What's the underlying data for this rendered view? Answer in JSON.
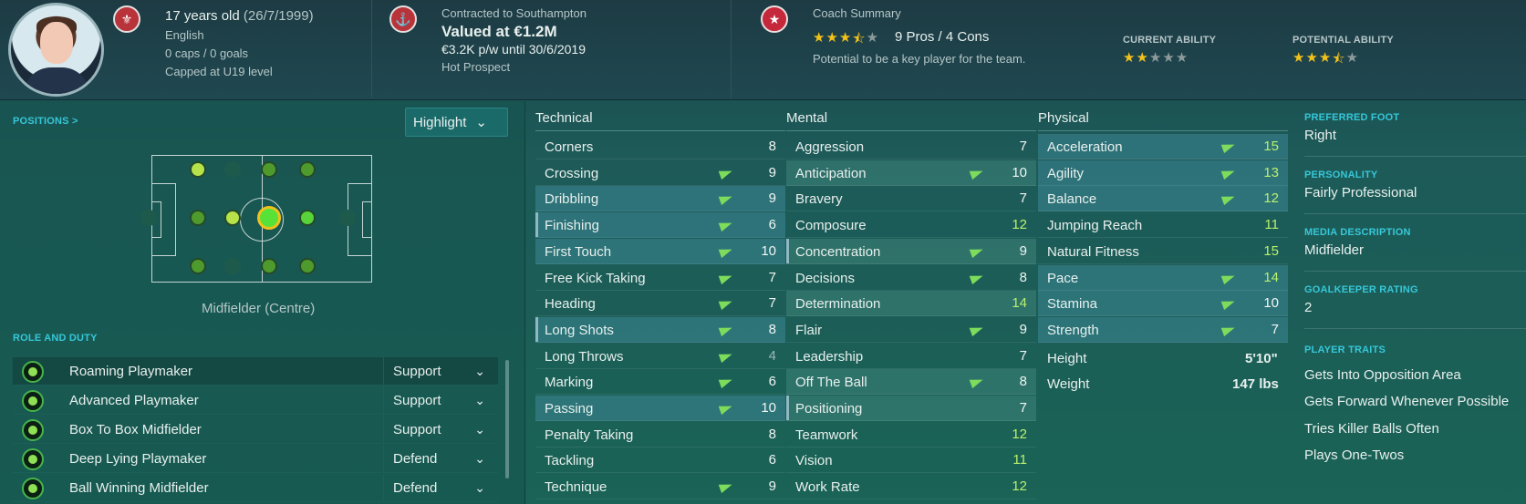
{
  "header": {
    "age": "17 years old",
    "dob": "(26/7/1999)",
    "nationality": "English",
    "caps": "0 caps / 0 goals",
    "capped_level": "Capped at U19 level",
    "contract": "Contracted to Southampton",
    "value": "Valued at €1.2M",
    "wage": "€3.2K p/w until 30/6/2019",
    "status": "Hot Prospect",
    "coach_title": "Coach Summary",
    "coach_rating_stars": 3.5,
    "pros_cons": "9 Pros / 4 Cons",
    "coach_text": "Potential to be a key player for the team.",
    "current_ability_label": "CURRENT ABILITY",
    "current_ability_stars": 2,
    "potential_ability_label": "POTENTIAL ABILITY",
    "potential_ability_stars": 3.5
  },
  "left": {
    "positions_label": "POSITIONS >",
    "highlight_label": "Highlight",
    "position_caption": "Midfielder (Centre)",
    "role_duty_label": "ROLE AND DUTY",
    "roles": [
      {
        "name": "Roaming Playmaker",
        "duty": "Support"
      },
      {
        "name": "Advanced Playmaker",
        "duty": "Support"
      },
      {
        "name": "Box To Box Midfielder",
        "duty": "Support"
      },
      {
        "name": "Deep Lying Playmaker",
        "duty": "Defend"
      },
      {
        "name": "Ball Winning Midfielder",
        "duty": "Defend"
      }
    ]
  },
  "attributes": {
    "technical_label": "Technical",
    "mental_label": "Mental",
    "physical_label": "Physical",
    "technical": [
      {
        "name": "Corners",
        "value": "8"
      },
      {
        "name": "Crossing",
        "value": "9"
      },
      {
        "name": "Dribbling",
        "value": "9"
      },
      {
        "name": "Finishing",
        "value": "6"
      },
      {
        "name": "First Touch",
        "value": "10"
      },
      {
        "name": "Free Kick Taking",
        "value": "7"
      },
      {
        "name": "Heading",
        "value": "7"
      },
      {
        "name": "Long Shots",
        "value": "8"
      },
      {
        "name": "Long Throws",
        "value": "4"
      },
      {
        "name": "Marking",
        "value": "6"
      },
      {
        "name": "Passing",
        "value": "10"
      },
      {
        "name": "Penalty Taking",
        "value": "8"
      },
      {
        "name": "Tackling",
        "value": "6"
      },
      {
        "name": "Technique",
        "value": "9"
      }
    ],
    "mental": [
      {
        "name": "Aggression",
        "value": "7"
      },
      {
        "name": "Anticipation",
        "value": "10"
      },
      {
        "name": "Bravery",
        "value": "7"
      },
      {
        "name": "Composure",
        "value": "12"
      },
      {
        "name": "Concentration",
        "value": "9"
      },
      {
        "name": "Decisions",
        "value": "8"
      },
      {
        "name": "Determination",
        "value": "14"
      },
      {
        "name": "Flair",
        "value": "9"
      },
      {
        "name": "Leadership",
        "value": "7"
      },
      {
        "name": "Off The Ball",
        "value": "8"
      },
      {
        "name": "Positioning",
        "value": "7"
      },
      {
        "name": "Teamwork",
        "value": "12"
      },
      {
        "name": "Vision",
        "value": "11"
      },
      {
        "name": "Work Rate",
        "value": "12"
      }
    ],
    "physical": [
      {
        "name": "Acceleration",
        "value": "15"
      },
      {
        "name": "Agility",
        "value": "13"
      },
      {
        "name": "Balance",
        "value": "12"
      },
      {
        "name": "Jumping Reach",
        "value": "11"
      },
      {
        "name": "Natural Fitness",
        "value": "15"
      },
      {
        "name": "Pace",
        "value": "14"
      },
      {
        "name": "Stamina",
        "value": "10"
      },
      {
        "name": "Strength",
        "value": "7"
      }
    ],
    "height_label": "Height",
    "height": "5'10\"",
    "weight_label": "Weight",
    "weight": "147 lbs"
  },
  "right": {
    "preferred_foot_label": "PREFERRED FOOT",
    "preferred_foot": "Right",
    "personality_label": "PERSONALITY",
    "personality": "Fairly Professional",
    "media_label": "MEDIA DESCRIPTION",
    "media": "Midfielder",
    "gk_label": "GOALKEEPER RATING",
    "gk": "2",
    "traits_label": "PLAYER TRAITS",
    "traits": [
      "Gets Into Opposition Area",
      "Gets Forward Whenever Possible",
      "Tries Killer Balls Often",
      "Plays One-Twos"
    ]
  },
  "colors": {
    "accent": "#36c7d8",
    "high_value": "#b9f06e",
    "star": "#f2c21b"
  }
}
